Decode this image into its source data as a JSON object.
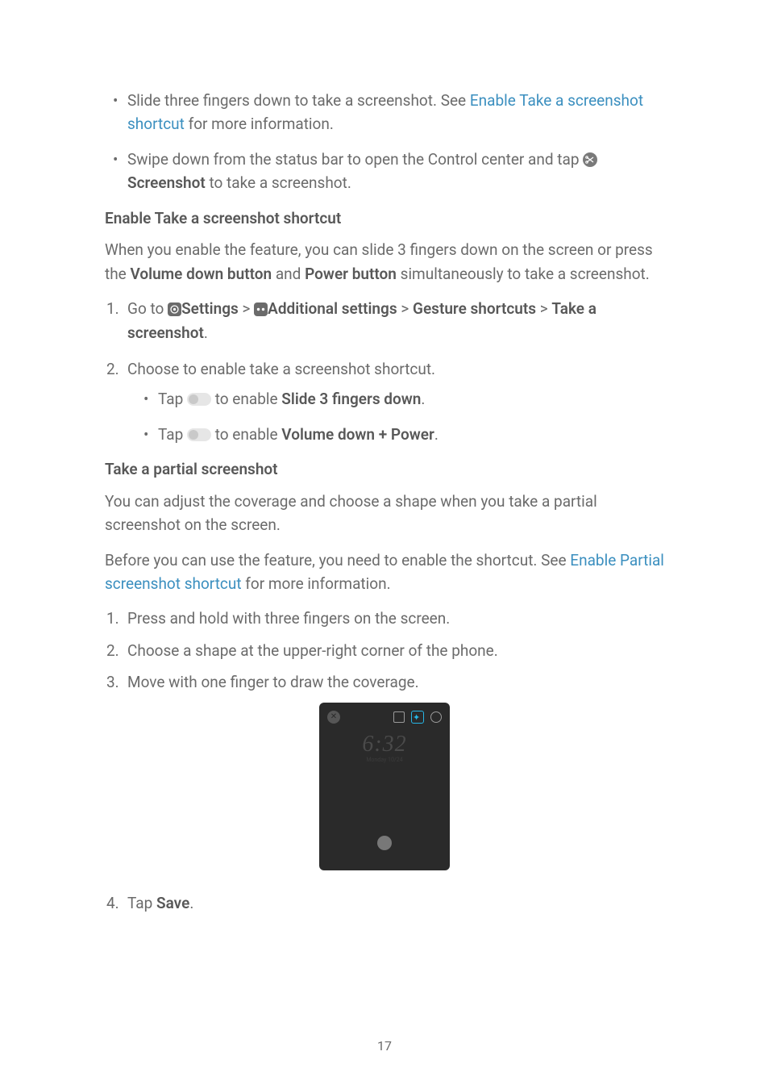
{
  "bul1a_pre": "Slide three fingers down to take a screenshot. See ",
  "bul1a_link": "Enable Take a screenshot shortcut",
  "bul1a_post": " for more information.",
  "bul1b_pre": "Swipe down from the status bar to open the Control center and tap ",
  "bul1b_bold": "Screenshot",
  "bul1b_post": " to take a screenshot.",
  "h1": "Enable Take a screenshot shortcut",
  "p1_a": "When you enable the feature, you can slide 3 fingers down on the screen or press the ",
  "p1_b": "Volume down button",
  "p1_c": " and ",
  "p1_d": "Power button",
  "p1_e": " simultaneously to take a screenshot.",
  "ol1_1_a": "Go to ",
  "ol1_1_b": "Settings",
  "ol1_1_c": "Additional settings",
  "ol1_1_d": "Gesture shortcuts",
  "ol1_1_e": "Take a screenshot",
  "ol1_2": "Choose to enable take a screenshot shortcut.",
  "sb1_a": "Tap ",
  "sb1_b": " to enable ",
  "sb1_c": "Slide 3 fingers down",
  "sb2_a": "Tap ",
  "sb2_b": " to enable ",
  "sb2_c": "Volume down + Power",
  "h2": "Take a partial screenshot",
  "p2": "You can adjust the coverage and choose a shape when you take a partial screenshot on the screen.",
  "p3_a": "Before you can use the feature, you need to enable the shortcut. See ",
  "p3_link": "Enable Partial screenshot shortcut",
  "p3_b": " for more information.",
  "ol2_1": "Press and hold with three fingers on the screen.",
  "ol2_2": "Choose a shape at the upper-right corner of the phone.",
  "ol2_3": "Move with one finger to draw the coverage.",
  "ol2_4_a": "Tap ",
  "ol2_4_b": "Save",
  "gt": " > ",
  "period": ".",
  "time": "6:32",
  "timesub": "Monday 10/24",
  "pagenum": "17",
  "n1": "1.",
  "n2": "2.",
  "n3": "3.",
  "n4": "4."
}
